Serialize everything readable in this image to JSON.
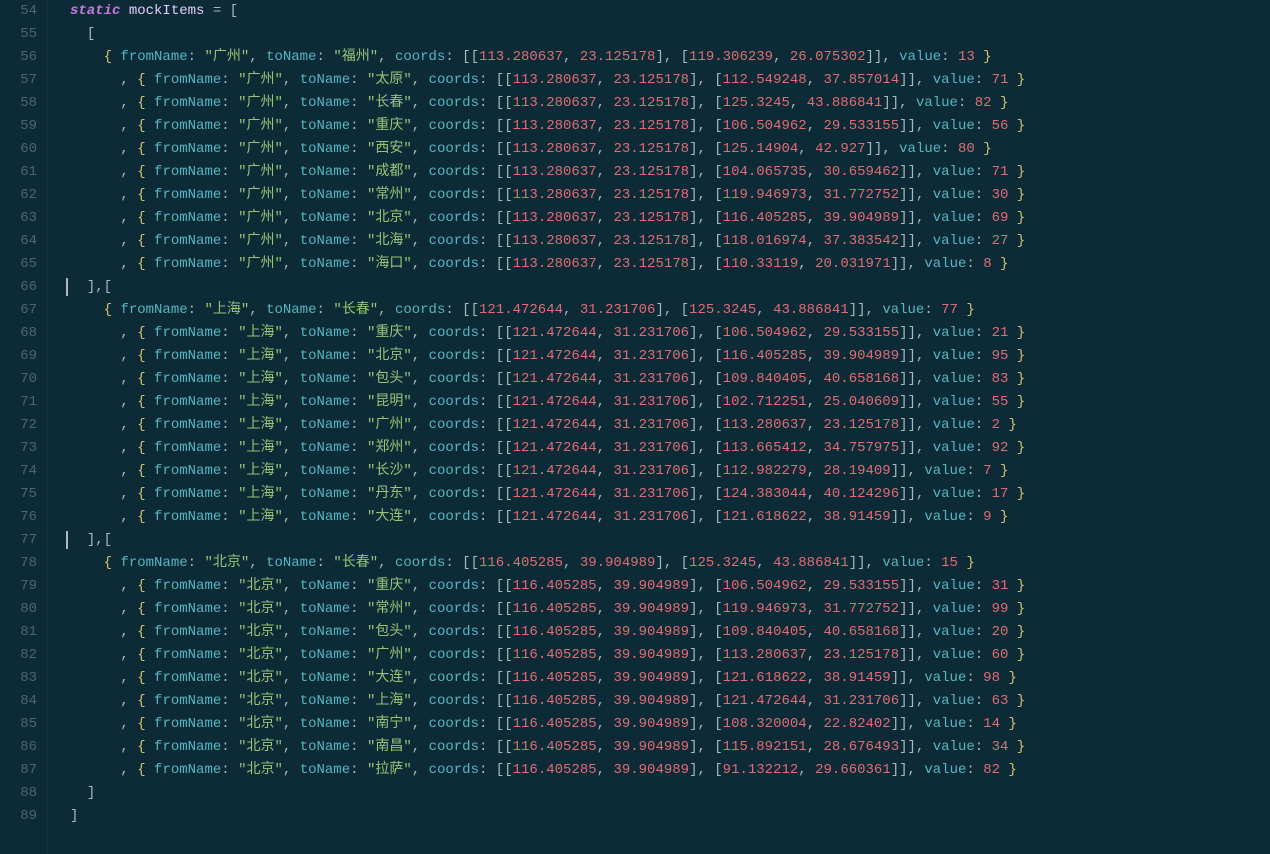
{
  "startLine": 54,
  "endLine": 89,
  "cursorLines": [
    66,
    77
  ],
  "declaration": {
    "keyword": "static",
    "name": "mockItems",
    "op": "=",
    "open": "["
  },
  "groups": [
    {
      "items": [
        {
          "fromName": "广州",
          "toName": "福州",
          "c1": [
            113.280637,
            23.125178
          ],
          "c2": [
            119.306239,
            26.075302
          ],
          "value": 13
        },
        {
          "fromName": "广州",
          "toName": "太原",
          "c1": [
            113.280637,
            23.125178
          ],
          "c2": [
            112.549248,
            37.857014
          ],
          "value": 71
        },
        {
          "fromName": "广州",
          "toName": "长春",
          "c1": [
            113.280637,
            23.125178
          ],
          "c2": [
            125.3245,
            43.886841
          ],
          "value": 82
        },
        {
          "fromName": "广州",
          "toName": "重庆",
          "c1": [
            113.280637,
            23.125178
          ],
          "c2": [
            106.504962,
            29.533155
          ],
          "value": 56
        },
        {
          "fromName": "广州",
          "toName": "西安",
          "c1": [
            113.280637,
            23.125178
          ],
          "c2": [
            125.14904,
            42.927
          ],
          "value": 80
        },
        {
          "fromName": "广州",
          "toName": "成都",
          "c1": [
            113.280637,
            23.125178
          ],
          "c2": [
            104.065735,
            30.659462
          ],
          "value": 71
        },
        {
          "fromName": "广州",
          "toName": "常州",
          "c1": [
            113.280637,
            23.125178
          ],
          "c2": [
            119.946973,
            31.772752
          ],
          "value": 30
        },
        {
          "fromName": "广州",
          "toName": "北京",
          "c1": [
            113.280637,
            23.125178
          ],
          "c2": [
            116.405285,
            39.904989
          ],
          "value": 69
        },
        {
          "fromName": "广州",
          "toName": "北海",
          "c1": [
            113.280637,
            23.125178
          ],
          "c2": [
            118.016974,
            37.383542
          ],
          "value": 27
        },
        {
          "fromName": "广州",
          "toName": "海口",
          "c1": [
            113.280637,
            23.125178
          ],
          "c2": [
            110.33119,
            20.031971
          ],
          "value": 8
        }
      ]
    },
    {
      "items": [
        {
          "fromName": "上海",
          "toName": "长春",
          "c1": [
            121.472644,
            31.231706
          ],
          "c2": [
            125.3245,
            43.886841
          ],
          "value": 77
        },
        {
          "fromName": "上海",
          "toName": "重庆",
          "c1": [
            121.472644,
            31.231706
          ],
          "c2": [
            106.504962,
            29.533155
          ],
          "value": 21
        },
        {
          "fromName": "上海",
          "toName": "北京",
          "c1": [
            121.472644,
            31.231706
          ],
          "c2": [
            116.405285,
            39.904989
          ],
          "value": 95
        },
        {
          "fromName": "上海",
          "toName": "包头",
          "c1": [
            121.472644,
            31.231706
          ],
          "c2": [
            109.840405,
            40.658168
          ],
          "value": 83
        },
        {
          "fromName": "上海",
          "toName": "昆明",
          "c1": [
            121.472644,
            31.231706
          ],
          "c2": [
            102.712251,
            25.040609
          ],
          "value": 55
        },
        {
          "fromName": "上海",
          "toName": "广州",
          "c1": [
            121.472644,
            31.231706
          ],
          "c2": [
            113.280637,
            23.125178
          ],
          "value": 2
        },
        {
          "fromName": "上海",
          "toName": "郑州",
          "c1": [
            121.472644,
            31.231706
          ],
          "c2": [
            113.665412,
            34.757975
          ],
          "value": 92
        },
        {
          "fromName": "上海",
          "toName": "长沙",
          "c1": [
            121.472644,
            31.231706
          ],
          "c2": [
            112.982279,
            28.19409
          ],
          "value": 7
        },
        {
          "fromName": "上海",
          "toName": "丹东",
          "c1": [
            121.472644,
            31.231706
          ],
          "c2": [
            124.383044,
            40.124296
          ],
          "value": 17
        },
        {
          "fromName": "上海",
          "toName": "大连",
          "c1": [
            121.472644,
            31.231706
          ],
          "c2": [
            121.618622,
            38.91459
          ],
          "value": 9
        }
      ]
    },
    {
      "items": [
        {
          "fromName": "北京",
          "toName": "长春",
          "c1": [
            116.405285,
            39.904989
          ],
          "c2": [
            125.3245,
            43.886841
          ],
          "value": 15
        },
        {
          "fromName": "北京",
          "toName": "重庆",
          "c1": [
            116.405285,
            39.904989
          ],
          "c2": [
            106.504962,
            29.533155
          ],
          "value": 31
        },
        {
          "fromName": "北京",
          "toName": "常州",
          "c1": [
            116.405285,
            39.904989
          ],
          "c2": [
            119.946973,
            31.772752
          ],
          "value": 99
        },
        {
          "fromName": "北京",
          "toName": "包头",
          "c1": [
            116.405285,
            39.904989
          ],
          "c2": [
            109.840405,
            40.658168
          ],
          "value": 20
        },
        {
          "fromName": "北京",
          "toName": "广州",
          "c1": [
            116.405285,
            39.904989
          ],
          "c2": [
            113.280637,
            23.125178
          ],
          "value": 60
        },
        {
          "fromName": "北京",
          "toName": "大连",
          "c1": [
            116.405285,
            39.904989
          ],
          "c2": [
            121.618622,
            38.91459
          ],
          "value": 98
        },
        {
          "fromName": "北京",
          "toName": "上海",
          "c1": [
            116.405285,
            39.904989
          ],
          "c2": [
            121.472644,
            31.231706
          ],
          "value": 63
        },
        {
          "fromName": "北京",
          "toName": "南宁",
          "c1": [
            116.405285,
            39.904989
          ],
          "c2": [
            108.320004,
            22.82402
          ],
          "value": 14
        },
        {
          "fromName": "北京",
          "toName": "南昌",
          "c1": [
            116.405285,
            39.904989
          ],
          "c2": [
            115.892151,
            28.676493
          ],
          "value": 34
        },
        {
          "fromName": "北京",
          "toName": "拉萨",
          "c1": [
            116.405285,
            39.904989
          ],
          "c2": [
            91.132212,
            29.660361
          ],
          "value": 82
        }
      ]
    }
  ],
  "labels": {
    "fromName": "fromName",
    "toName": "toName",
    "coords": "coords",
    "value": "value"
  }
}
